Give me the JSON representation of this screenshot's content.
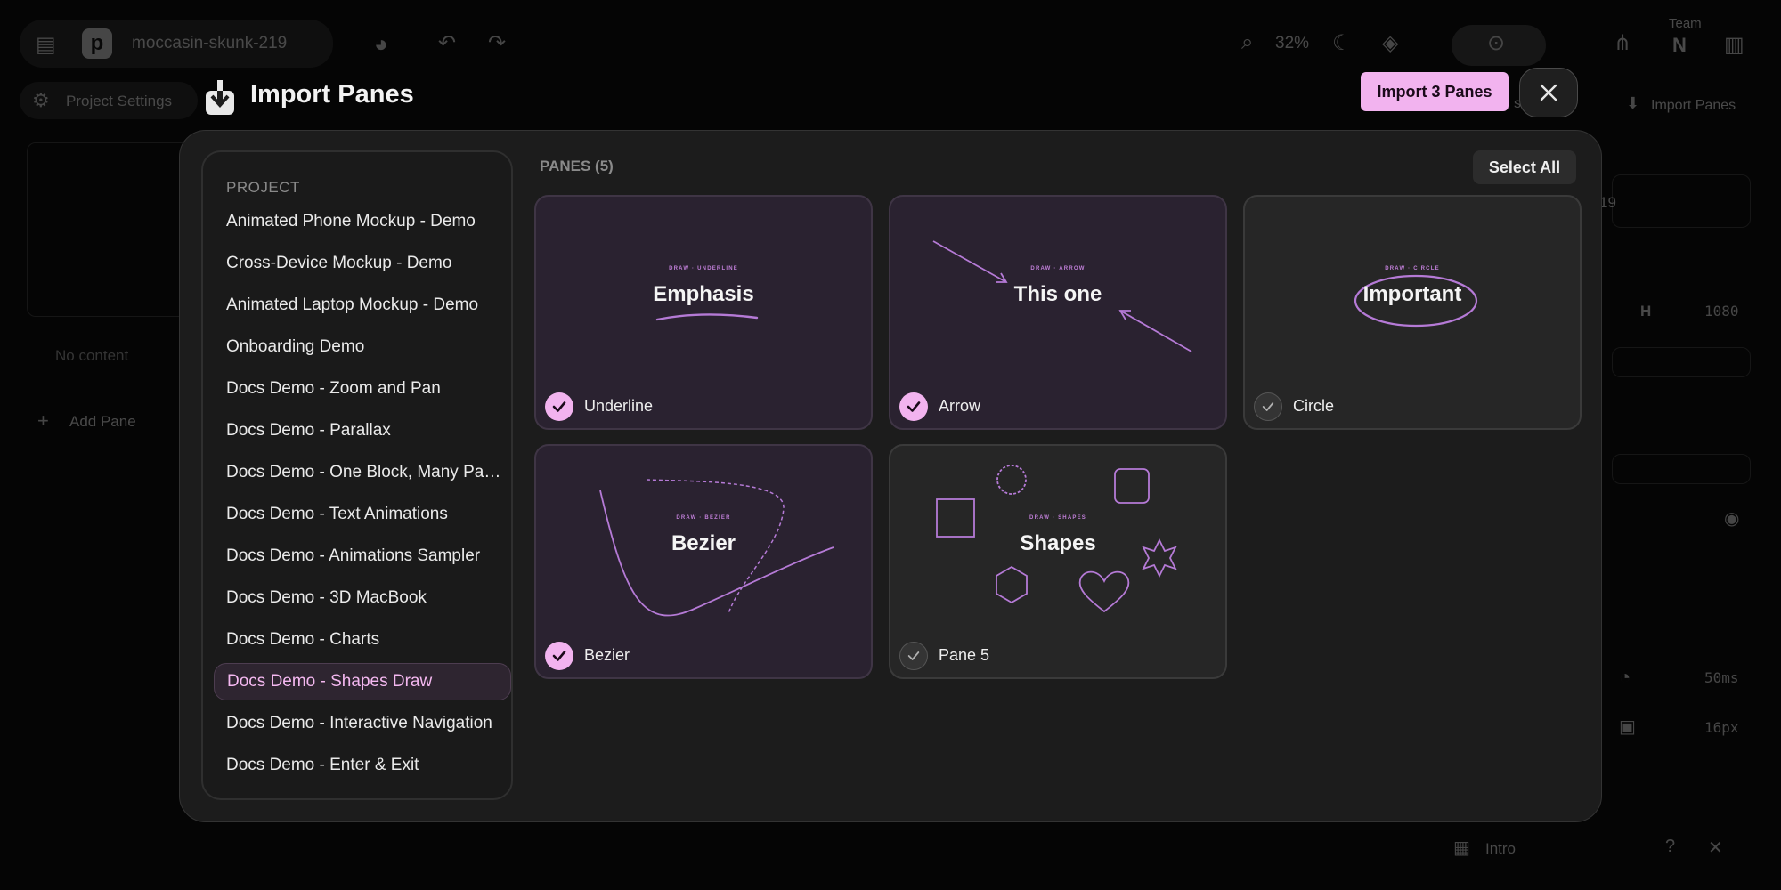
{
  "app": {
    "project_name": "moccasin-skunk-219",
    "zoom_level": "32%",
    "team_label": "Team",
    "team_initial": "N",
    "project_settings_label": "Project Settings",
    "import_panes_label": "Import Panes",
    "no_content_label": "No content",
    "add_pane_label": "Add Pane",
    "height_label": "H",
    "height_value": "1080",
    "duration_value": "50ms",
    "spacing_value": "16px",
    "intro_label": "Intro",
    "partial_s": "s",
    "partial_19": "19"
  },
  "modal": {
    "title": "Import Panes",
    "import_button_label": "Import 3 Panes",
    "project_section_label": "PROJECT",
    "panes_section_label": "PANES (5)",
    "select_all_label": "Select All",
    "projects": [
      {
        "label": "Animated Phone Mockup - Demo"
      },
      {
        "label": "Cross-Device Mockup - Demo"
      },
      {
        "label": "Animated Laptop Mockup - Demo"
      },
      {
        "label": "Onboarding Demo"
      },
      {
        "label": "Docs Demo - Zoom and Pan"
      },
      {
        "label": "Docs Demo - Parallax"
      },
      {
        "label": "Docs Demo - One Block, Many Panes"
      },
      {
        "label": "Docs Demo - Text Animations"
      },
      {
        "label": "Docs Demo - Animations Sampler"
      },
      {
        "label": "Docs Demo - 3D MacBook"
      },
      {
        "label": "Docs Demo - Charts"
      },
      {
        "label": "Docs Demo - Shapes Draw"
      },
      {
        "label": "Docs Demo - Interactive Navigation"
      },
      {
        "label": "Docs Demo - Enter & Exit"
      }
    ],
    "selected_project": "Docs Demo - Shapes Draw",
    "panes": [
      {
        "name": "Underline",
        "eyebrow": "DRAW · UNDERLINE",
        "heading": "Emphasis",
        "checked": true
      },
      {
        "name": "Arrow",
        "eyebrow": "DRAW · ARROW",
        "heading": "This one",
        "checked": true
      },
      {
        "name": "Circle",
        "eyebrow": "DRAW · CIRCLE",
        "heading": "Important",
        "checked": false
      },
      {
        "name": "Bezier",
        "eyebrow": "DRAW · BEZIER",
        "heading": "Bezier",
        "checked": true
      },
      {
        "name": "Pane 5",
        "eyebrow": "DRAW · SHAPES",
        "heading": "Shapes",
        "checked": false
      }
    ]
  },
  "colors": {
    "accent": "#f2b3ef",
    "stroke": "#b57ad6",
    "background": "#050505",
    "modal": "#1c1c1c"
  }
}
